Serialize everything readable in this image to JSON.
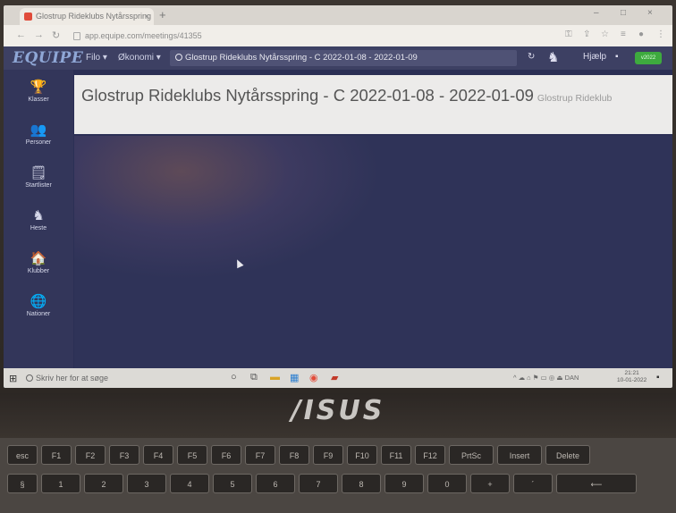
{
  "browser": {
    "tab_title": "Glostrup Rideklubs Nytårsspring",
    "tab_close": "×",
    "new_tab": "+",
    "url": "app.equipe.com/meetings/41355",
    "window_controls": [
      "–",
      "□",
      "×"
    ],
    "nav_icons": [
      "back-icon",
      "forward-icon",
      "reload-icon"
    ]
  },
  "app_nav": {
    "logo": "EQUIPE",
    "menu_items": [
      {
        "label": "Filo ▾"
      },
      {
        "label": "Økonomi ▾"
      }
    ],
    "search_value": "Glostrup Rideklubs Nytårsspring - C 2022-01-08 - 2022-01-09",
    "right": {
      "refresh_icon": "↻",
      "horse_icon": "♞",
      "help_label": "Hjælp",
      "chat_icon": "▪",
      "version_badge": "v2022"
    }
  },
  "sidebar": {
    "items": [
      {
        "label": "Klasser",
        "icon": "🏆"
      },
      {
        "label": "Personer",
        "icon": "👥"
      },
      {
        "label": "Startlister",
        "icon": "🗒"
      },
      {
        "label": "Heste",
        "icon": "♞"
      },
      {
        "label": "Klubber",
        "icon": "🏠"
      },
      {
        "label": "Nationer",
        "icon": "🌐"
      }
    ]
  },
  "banner": {
    "title": "Glostrup Rideklubs Nytårsspring - C 2022-01-08 - 2022-01-09",
    "subtitle": "Glostrup Rideklub"
  },
  "taskbar": {
    "search_placeholder": "Skriv her for at søge",
    "start_icon": "⊞",
    "tray_text": "^ ☁ ⌂ ⚑ ▭ ◎ ⏏ DAN",
    "clock_time": "21:21",
    "clock_date": "10-01-2022",
    "notif_icon": "▪"
  },
  "device": {
    "brand": "/ISUS",
    "keys": [
      "esc",
      "F1",
      "F2",
      "F3",
      "F4",
      "F5",
      "F6",
      "F7",
      "F8",
      "F9",
      "F10",
      "F11",
      "F12",
      "PrtSc",
      "Insert",
      "Delete",
      "§",
      "1",
      "2",
      "3",
      "4",
      "5",
      "6",
      "7",
      "8",
      "9",
      "0",
      "+",
      "´",
      "⟵"
    ]
  }
}
